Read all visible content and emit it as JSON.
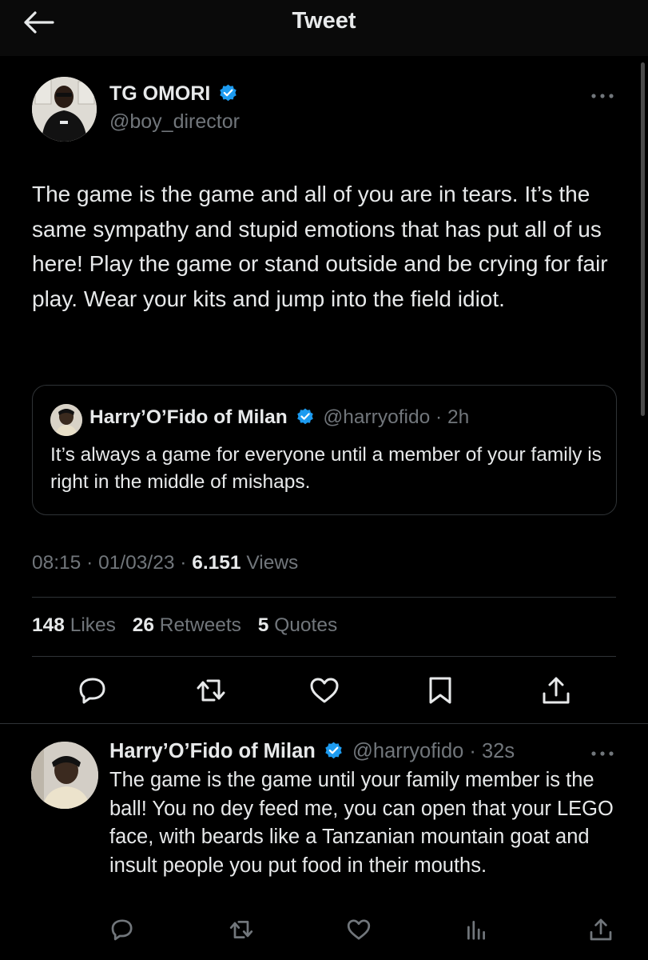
{
  "header": {
    "title": "Tweet",
    "back_icon": "arrow-left-icon"
  },
  "tweet": {
    "author_name": "TG OMORI",
    "author_handle": "@boy_director",
    "text": "The game is the game and all of you are in tears. It’s the same sympathy and stupid emotions that has put all of us here! Play the game or stand outside and be crying for fair play. Wear your kits and jump into the field idiot.",
    "quote": {
      "author_name": "Harry’O’Fido of Milan",
      "author_handle": "@harryofido",
      "time": "· 2h",
      "text": "It’s always a game for everyone until a member of your family is right in the middle of mishaps."
    },
    "time": "08:15",
    "date": "01/03/23",
    "views_count": "6.151",
    "views_label": "Views",
    "likes_count": "148",
    "likes_label": "Likes",
    "retweets_count": "26",
    "retweets_label": "Retweets",
    "quotes_count": "5",
    "quotes_label": "Quotes"
  },
  "reply": {
    "author_name": "Harry’O’Fido of Milan",
    "author_handle": "@harryofido",
    "time": "· 32s",
    "text": "The game is the game until your family member is the ball! You no dey feed me, you can open that your LEGO face, with beards like a Tanzanian mountain goat and insult people you put food in their mouths."
  },
  "icons": [
    "reply-icon",
    "retweet-icon",
    "like-icon",
    "bookmark-icon",
    "share-icon",
    "analytics-icon",
    "more-icon",
    "verified-badge-icon"
  ],
  "colors": {
    "background": "#000000",
    "header": "#0a0a0a",
    "text": "#e7e9ea",
    "secondary": "#71767b",
    "verified": "#1d9bf0",
    "border": "#2f3336"
  }
}
